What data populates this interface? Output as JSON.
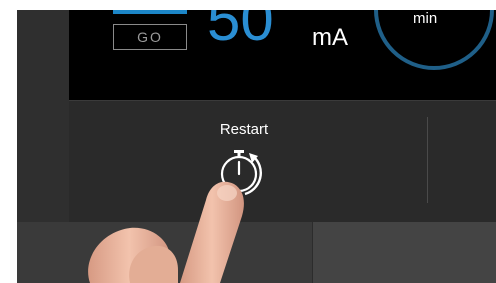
{
  "display": {
    "go_label": "GO",
    "current_value": "50",
    "current_unit": "mA",
    "timer_unit": "min"
  },
  "controls": {
    "restart_label": "Restart",
    "restart_icon": "stopwatch-restart-icon"
  },
  "colors": {
    "accent_blue": "#2a8ed3",
    "screen_bg": "#000000",
    "panel_bg": "#2a2a2a"
  }
}
